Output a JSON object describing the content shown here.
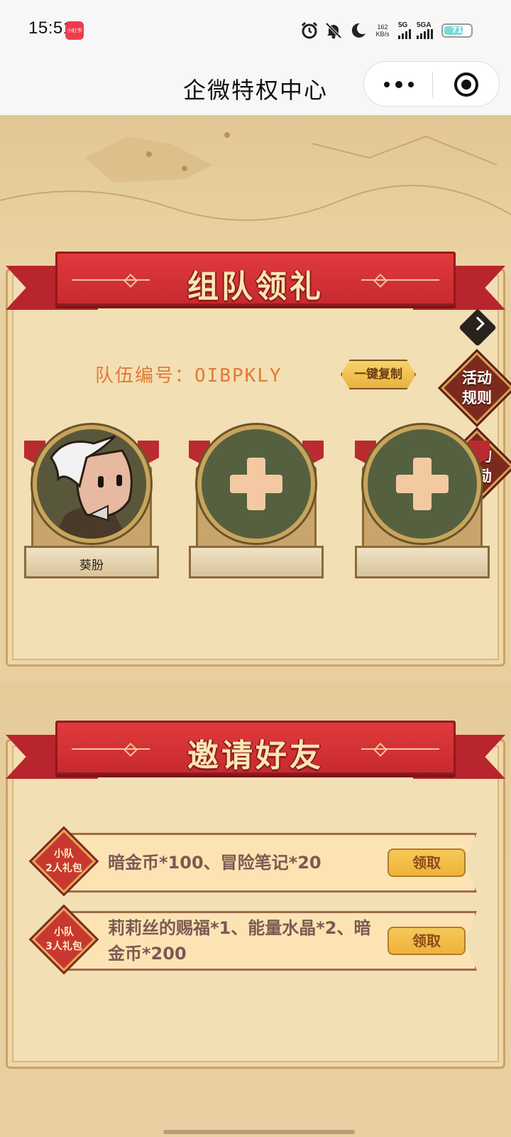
{
  "status_bar": {
    "time": "15:51",
    "app_badge": "小红书",
    "net_speed_value": "162",
    "net_speed_unit": "KB/s",
    "sim1_label": "5G",
    "sim2_label": "5GA",
    "battery_level": "71",
    "icons": [
      "alarm-icon",
      "mute-bell-icon",
      "moon-icon"
    ]
  },
  "header": {
    "title": "企微特权中心",
    "capsule_more": "more-icon",
    "capsule_close": "close-miniprogram-icon"
  },
  "team": {
    "banner_title": "组队领礼",
    "team_id_label": "队伍编号：",
    "team_id_value": "OIBPKLY",
    "copy_button": "一键复制",
    "rules_badge": "活动\n规则",
    "rewards_badge": "我的\n奖励",
    "members": [
      {
        "name": "葵朌",
        "filled": true
      },
      {
        "name": "",
        "filled": false
      },
      {
        "name": "",
        "filled": false
      }
    ]
  },
  "invite": {
    "banner_title": "邀请好友",
    "rewards": [
      {
        "badge": "小队\n2人礼包",
        "text": "暗金币*100、冒险笔记*20",
        "button": "领取"
      },
      {
        "badge": "小队\n3人礼包",
        "text": "莉莉丝的赐福*1、能量水晶*2、暗金币*200",
        "button": "领取"
      }
    ]
  },
  "colors": {
    "ribbon_red": "#c82a2f",
    "parchment": "#f3dfb4",
    "team_id_orange": "#e07a34",
    "claim_gold": "#eeb23a"
  }
}
